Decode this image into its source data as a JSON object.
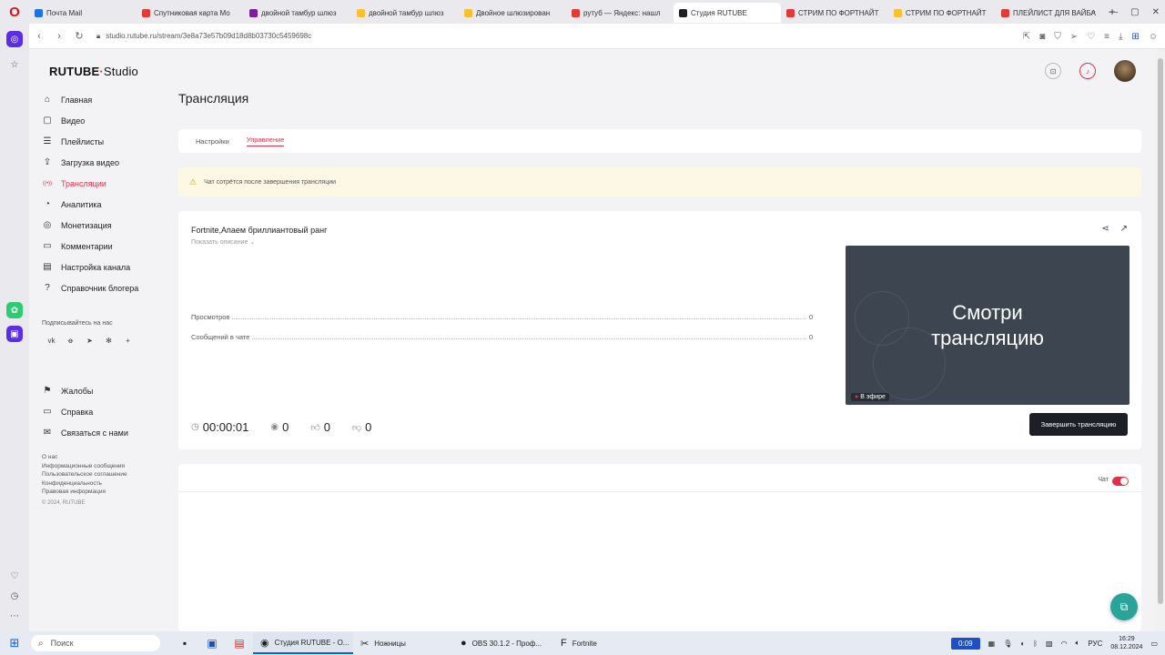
{
  "browser": {
    "tabs": [
      {
        "label": "Почта Mail",
        "color": "#1a73e8",
        "active": false
      },
      {
        "label": "Спутниковая карта Мо",
        "color": "#e53935",
        "active": false
      },
      {
        "label": "двойной тамбур шлюз",
        "color": "#7b1fa2",
        "active": false
      },
      {
        "label": "двойной тамбур шлюз",
        "color": "#fbc02d",
        "active": false
      },
      {
        "label": "Двойное шлюзирован",
        "color": "#fbc02d",
        "active": false
      },
      {
        "label": "рутуб — Яндекс: нашл",
        "color": "#e53935",
        "active": false
      },
      {
        "label": "Студия RUTUBE",
        "color": "#1c1f26",
        "active": true
      },
      {
        "label": "СТРИМ ПО ФОРТНАЙТ",
        "color": "#e53935",
        "active": false
      },
      {
        "label": "СТРИМ ПО ФОРТНАЙТ",
        "color": "#fbc02d",
        "active": false
      },
      {
        "label": "ПЛЕЙЛИСТ ДЛЯ ВАЙБА",
        "color": "#e53935",
        "active": false
      }
    ],
    "new_tab": "+",
    "url": "studio.rutube.ru/stream/3e8a73e57b09d18d8b03730c5459698c"
  },
  "app": {
    "logo_main": "RUTUBE",
    "logo_studio": "Studio",
    "nav": [
      {
        "label": "Главная",
        "icon": "⌂",
        "active": false
      },
      {
        "label": "Видео",
        "icon": "▢",
        "active": false
      },
      {
        "label": "Плейлисты",
        "icon": "☰",
        "active": false
      },
      {
        "label": "Загрузка видео",
        "icon": "⇪",
        "active": false
      },
      {
        "label": "Трансляции",
        "icon": "((•))",
        "active": true
      },
      {
        "label": "Аналитика",
        "icon": "◔",
        "active": false
      },
      {
        "label": "Монетизация",
        "icon": "◎",
        "active": false
      },
      {
        "label": "Комментарии",
        "icon": "▭",
        "active": false
      },
      {
        "label": "Настройка канала",
        "icon": "▤",
        "active": false
      },
      {
        "label": "Справочник блогера",
        "icon": "?",
        "active": false
      }
    ],
    "subscribe_label": "Подписывайтесь на нас",
    "socials": [
      "vk",
      "ok",
      "tg",
      "dzen",
      "+"
    ],
    "nav2": [
      {
        "label": "Жалобы",
        "icon": "⚑"
      },
      {
        "label": "Справка",
        "icon": "▭"
      },
      {
        "label": "Связаться с нами",
        "icon": "✉"
      }
    ],
    "footer_links": [
      "О нас",
      "Информационные сообщения",
      "Пользовательское соглашение",
      "Конфиденциальность",
      "Правовая информация"
    ],
    "copyright": "© 2024, RUTUBE",
    "page_title": "Трансляция",
    "tabs": [
      "Настройки",
      "Управление"
    ],
    "active_tab": "Управление",
    "notice": "Чат сотрётся после завершения трансляции",
    "stream": {
      "title": "Fortnite,Апаем бриллиантовый ранг",
      "show_description": "Показать описание",
      "stats": [
        {
          "label": "Просмотров",
          "value": "0"
        },
        {
          "label": "Сообщений в чате",
          "value": "0"
        }
      ],
      "preview_text_1": "Смотри",
      "preview_text_2": "трансляцию",
      "live_badge": "В эфире",
      "timer": "00:00:01",
      "viewers": "0",
      "likes": "0",
      "dislikes": "0",
      "end_button": "Завершить трансляцию"
    },
    "chat_label": "Чат",
    "chat_enabled": true
  },
  "taskbar": {
    "search_placeholder": "Поиск",
    "apps": [
      {
        "label": "Студия RUTUBE - O...",
        "icon": "◉",
        "active": true
      },
      {
        "label": "Ножницы",
        "icon": "✂",
        "active": false
      },
      {
        "label": "OBS 30.1.2 - Проф...",
        "icon": "●",
        "active": false
      },
      {
        "label": "Fortnite",
        "icon": "F",
        "active": false
      }
    ],
    "recording_time": "0:09",
    "language": "РУС",
    "time": "16:29",
    "date": "08.12.2024"
  },
  "colors": {
    "accent": "#e3304a",
    "button_dark": "#1c1f26",
    "notice_bg": "#fdf8e4",
    "help_button": "#2aa39a"
  }
}
